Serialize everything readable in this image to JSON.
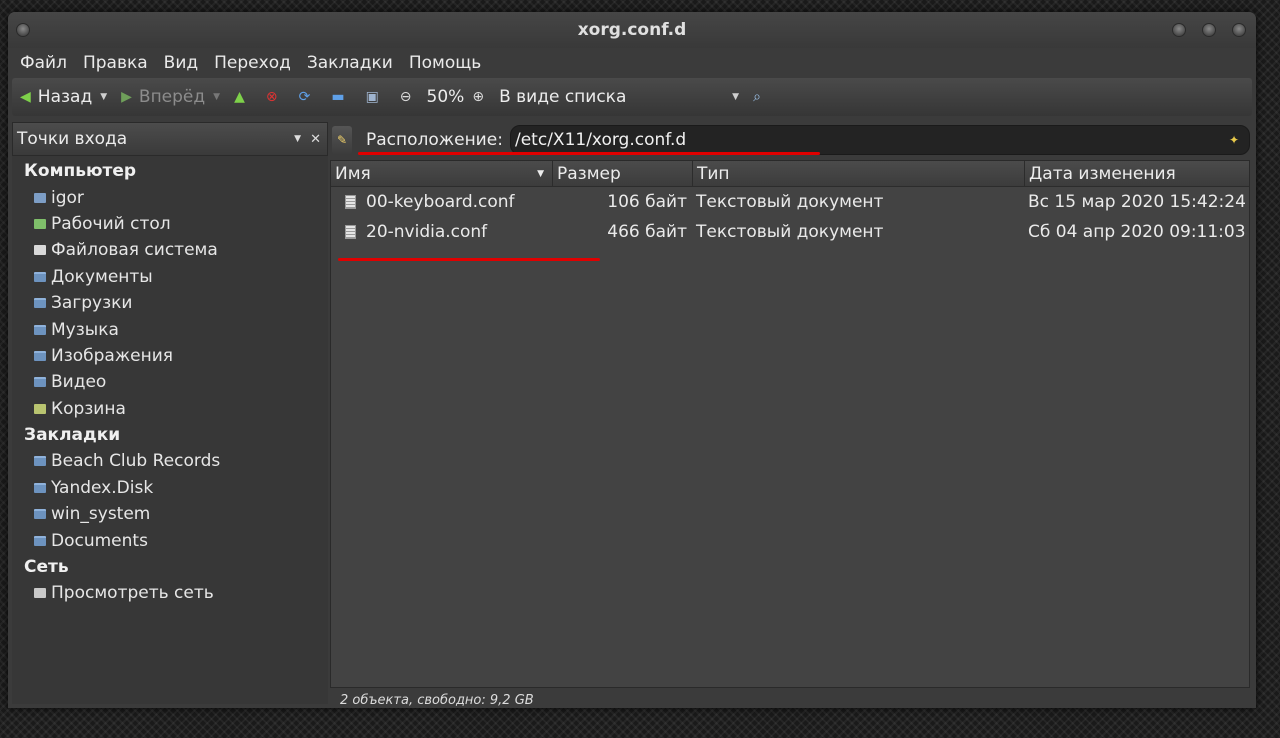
{
  "window": {
    "title": "xorg.conf.d"
  },
  "menu": [
    "Файл",
    "Правка",
    "Вид",
    "Переход",
    "Закладки",
    "Помощь"
  ],
  "toolbar": {
    "back": "Назад",
    "forward": "Вперёд",
    "zoom": "50%",
    "view_mode": "В виде списка"
  },
  "sidebar": {
    "selector": "Точки входа",
    "sections": [
      {
        "title": "Компьютер",
        "items": [
          {
            "label": "igor",
            "icon": "home-folder-icon"
          },
          {
            "label": "Рабочий стол",
            "icon": "desktop-icon"
          },
          {
            "label": "Файловая система",
            "icon": "filesystem-icon"
          },
          {
            "label": "Документы",
            "icon": "folder-icon"
          },
          {
            "label": "Загрузки",
            "icon": "folder-icon"
          },
          {
            "label": "Музыка",
            "icon": "folder-icon"
          },
          {
            "label": "Изображения",
            "icon": "folder-icon"
          },
          {
            "label": "Видео",
            "icon": "folder-icon"
          },
          {
            "label": "Корзина",
            "icon": "trash-icon"
          }
        ]
      },
      {
        "title": "Закладки",
        "items": [
          {
            "label": "Beach Club Records",
            "icon": "folder-icon"
          },
          {
            "label": "Yandex.Disk",
            "icon": "folder-icon"
          },
          {
            "label": "win_system",
            "icon": "folder-icon"
          },
          {
            "label": "Documents",
            "icon": "folder-icon"
          }
        ]
      },
      {
        "title": "Сеть",
        "items": [
          {
            "label": "Просмотреть сеть",
            "icon": "network-icon"
          }
        ]
      }
    ]
  },
  "location": {
    "label": "Расположение:",
    "path": "/etc/X11/xorg.conf.d"
  },
  "columns": {
    "name": "Имя",
    "size": "Размер",
    "type": "Тип",
    "modified": "Дата изменения"
  },
  "files": [
    {
      "name": "00-keyboard.conf",
      "size": "106 байт",
      "type": "Текстовый документ",
      "modified": "Вс 15 мар 2020 15:42:24"
    },
    {
      "name": "20-nvidia.conf",
      "size": "466 байт",
      "type": "Текстовый документ",
      "modified": "Сб 04 апр 2020 09:11:03"
    }
  ],
  "status": "2 объекта, свободно: 9,2 GB",
  "colors": {
    "annotation": "#e00000",
    "background": "#3b3b3b"
  }
}
